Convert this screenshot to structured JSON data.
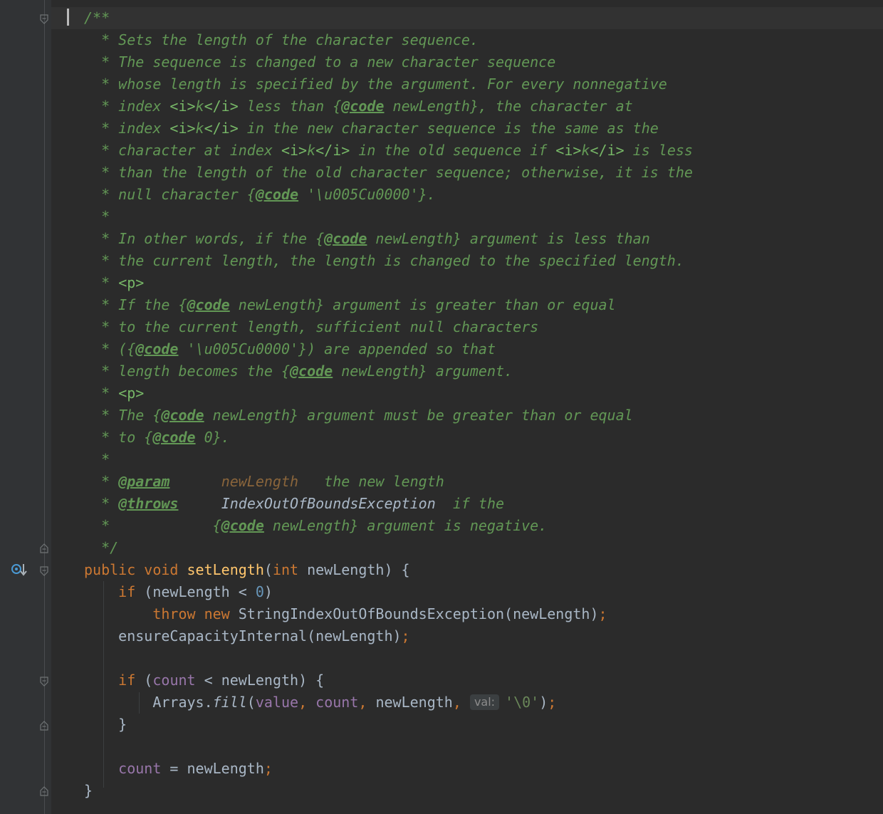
{
  "colors": {
    "background": "#2b2b2b",
    "gutter": "#313335",
    "doc_comment": "#629755",
    "keyword": "#cc7832",
    "method_name": "#ffc66d",
    "number": "#6897bb",
    "field": "#9876aa",
    "plain": "#a9b7c6"
  },
  "doc": {
    "open": "/**",
    "l1": "* Sets the length of the character sequence.",
    "l2": "* The sequence is changed to a new character sequence",
    "l3": "* whose length is specified by the argument. For every nonnegative",
    "l4": {
      "a": "* index ",
      "m1": "<i>",
      "b": "k",
      "m2": "</i>",
      "c": " less than {",
      "tag": "@code",
      "d": " newLength}, the character at"
    },
    "l5": {
      "a": "* index ",
      "m1": "<i>",
      "b": "k",
      "m2": "</i>",
      "c": " in the new character sequence is the same as the"
    },
    "l6": {
      "a": "* character at index ",
      "m1": "<i>",
      "b": "k",
      "m2": "</i>",
      "c": " in the old sequence if ",
      "m3": "<i>",
      "d": "k",
      "m4": "</i>",
      "e": " is less"
    },
    "l7": "* than the length of the old character sequence; otherwise, it is the",
    "l8": {
      "a": "* null character {",
      "tag": "@code",
      "b": " '\\u005Cu0000'}."
    },
    "l9": "*",
    "l10": {
      "a": "* In other words, if the {",
      "tag": "@code",
      "b": " newLength} argument is less than"
    },
    "l11": "* the current length, the length is changed to the specified length.",
    "l12": {
      "a": "* ",
      "m": "<p>"
    },
    "l13": {
      "a": "* If the {",
      "tag": "@code",
      "b": " newLength} argument is greater than or equal"
    },
    "l14": "* to the current length, sufficient null characters",
    "l15": {
      "a": "* ({",
      "tag": "@code",
      "b": " '\\u005Cu0000'}) are appended so that"
    },
    "l16": {
      "a": "* length becomes the {",
      "tag": "@code",
      "b": " newLength} argument."
    },
    "l17": {
      "a": "* ",
      "m": "<p>"
    },
    "l18": {
      "a": "* The {",
      "tag": "@code",
      "b": " newLength} argument must be greater than or equal"
    },
    "l19": {
      "a": "* to {",
      "tag": "@code",
      "b": " 0}."
    },
    "l20": "*",
    "l21": {
      "a": "* ",
      "tag": "@param",
      "gap": "      ",
      "param": "newLength",
      "b": "   the new length"
    },
    "l22": {
      "a": "* ",
      "tag": "@throws",
      "gap": "     ",
      "type": "IndexOutOfBoundsException",
      "b": "  if the"
    },
    "l23": {
      "a": "*            {",
      "tag": "@code",
      "b": " newLength} argument is negative."
    },
    "close": "*/"
  },
  "code": {
    "sig": {
      "k1": "public",
      "k2": "void",
      "name": "setLength",
      "p1": "(",
      "k3": "int",
      "p2": " newLength) {"
    },
    "if1": {
      "k": "if",
      "a": " (newLength < ",
      "n": "0",
      "b": ")"
    },
    "throw": {
      "k1": "throw",
      "k2": "new",
      "a": " StringIndexOutOfBoundsException(newLength)",
      "semi": ";"
    },
    "ensure": {
      "a": "ensureCapacityInternal(newLength)",
      "semi": ";"
    },
    "if2": {
      "k": "if",
      "a": " (",
      "f": "count",
      "b": " < newLength) {"
    },
    "fill": {
      "a": "Arrays.",
      "m": "fill",
      "b": "(",
      "f1": "value",
      "c1": ", ",
      "f2": "count",
      "c2": ", ",
      "c": "newLength",
      "c3": ", ",
      "hint": "val:",
      "s": "'\\0'",
      "d": ")",
      "semi": ";"
    },
    "close1": "}",
    "assign": {
      "f": "count",
      "a": " = newLength",
      "semi": ";"
    },
    "close2": "}"
  },
  "icons": {
    "override": "override-method-icon",
    "fold": "fold-marker-icon"
  }
}
